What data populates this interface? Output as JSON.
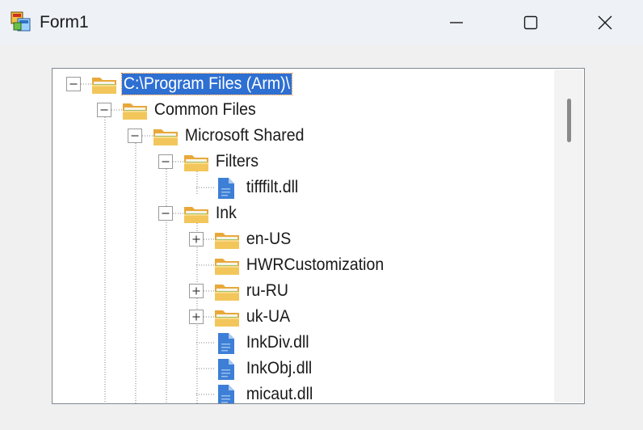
{
  "window": {
    "title": "Form1",
    "app_icon": "form-app-icon",
    "minimize_icon": "minimize-icon",
    "maximize_icon": "maximize-icon",
    "close_icon": "close-icon"
  },
  "tree": {
    "nodes": [
      {
        "label": "C:\\Program Files (Arm)\\",
        "type": "folder",
        "expander": "minus",
        "selected": true
      },
      {
        "label": "Common Files",
        "type": "folder",
        "expander": "minus"
      },
      {
        "label": "Microsoft Shared",
        "type": "folder",
        "expander": "minus"
      },
      {
        "label": "Filters",
        "type": "folder",
        "expander": "minus"
      },
      {
        "label": "tifffilt.dll",
        "type": "file",
        "expander": "none"
      },
      {
        "label": "Ink",
        "type": "folder",
        "expander": "minus"
      },
      {
        "label": "en-US",
        "type": "folder",
        "expander": "plus"
      },
      {
        "label": "HWRCustomization",
        "type": "folder",
        "expander": "none"
      },
      {
        "label": "ru-RU",
        "type": "folder",
        "expander": "plus"
      },
      {
        "label": "uk-UA",
        "type": "folder",
        "expander": "plus"
      },
      {
        "label": "InkDiv.dll",
        "type": "file",
        "expander": "none"
      },
      {
        "label": "InkObj.dll",
        "type": "file",
        "expander": "none"
      },
      {
        "label": "micaut.dll",
        "type": "file",
        "expander": "none"
      }
    ]
  },
  "colors": {
    "selection": "#2e6fd2",
    "folder": "#f2c65a",
    "file": "#3d7fd6"
  }
}
